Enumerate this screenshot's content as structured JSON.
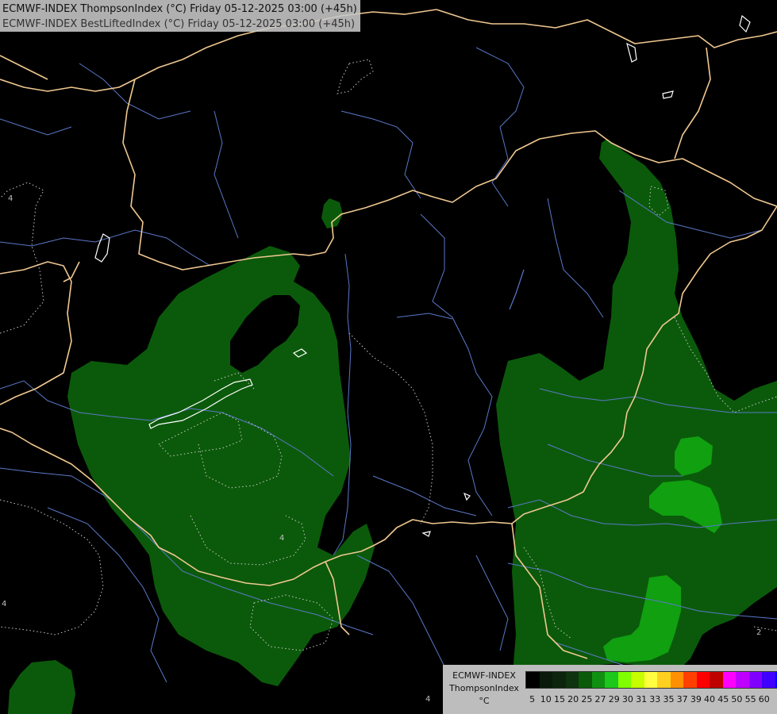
{
  "header": {
    "line1": "ECMWF-INDEX ThompsonIndex (°C) Friday 05-12-2025 03:00 (+45h)",
    "line2": "ECMWF-INDEX BestLiftedIndex (°C) Friday 05-12-2025 03:00 (+45h)"
  },
  "legend": {
    "source": "ECMWF-INDEX",
    "variable": "ThompsonIndex",
    "unit": "°C",
    "ticks": [
      "5",
      "10",
      "15",
      "20",
      "25",
      "27",
      "29",
      "30",
      "31",
      "33",
      "35",
      "37",
      "39",
      "40",
      "45",
      "50",
      "55",
      "60"
    ],
    "colors": [
      "#000000",
      "#0a1a0a",
      "#0c240c",
      "#0f320f",
      "#0a5a0a",
      "#109010",
      "#1cc81c",
      "#80ff00",
      "#c8ff00",
      "#ffff40",
      "#ffd020",
      "#ff9000",
      "#ff4000",
      "#ff0000",
      "#c00000",
      "#ff00ff",
      "#c000ff",
      "#8000ff",
      "#4000ff",
      "#0000ff"
    ]
  },
  "contour_labels": [
    "4",
    "4",
    "4",
    "4",
    "2"
  ],
  "colors": {
    "background": "#000000",
    "fill_low": "#0b5a0b",
    "fill_high": "#10a010",
    "borders": "#f0c890",
    "rivers": "#5a78c8",
    "contours": "#c8c8c8"
  }
}
